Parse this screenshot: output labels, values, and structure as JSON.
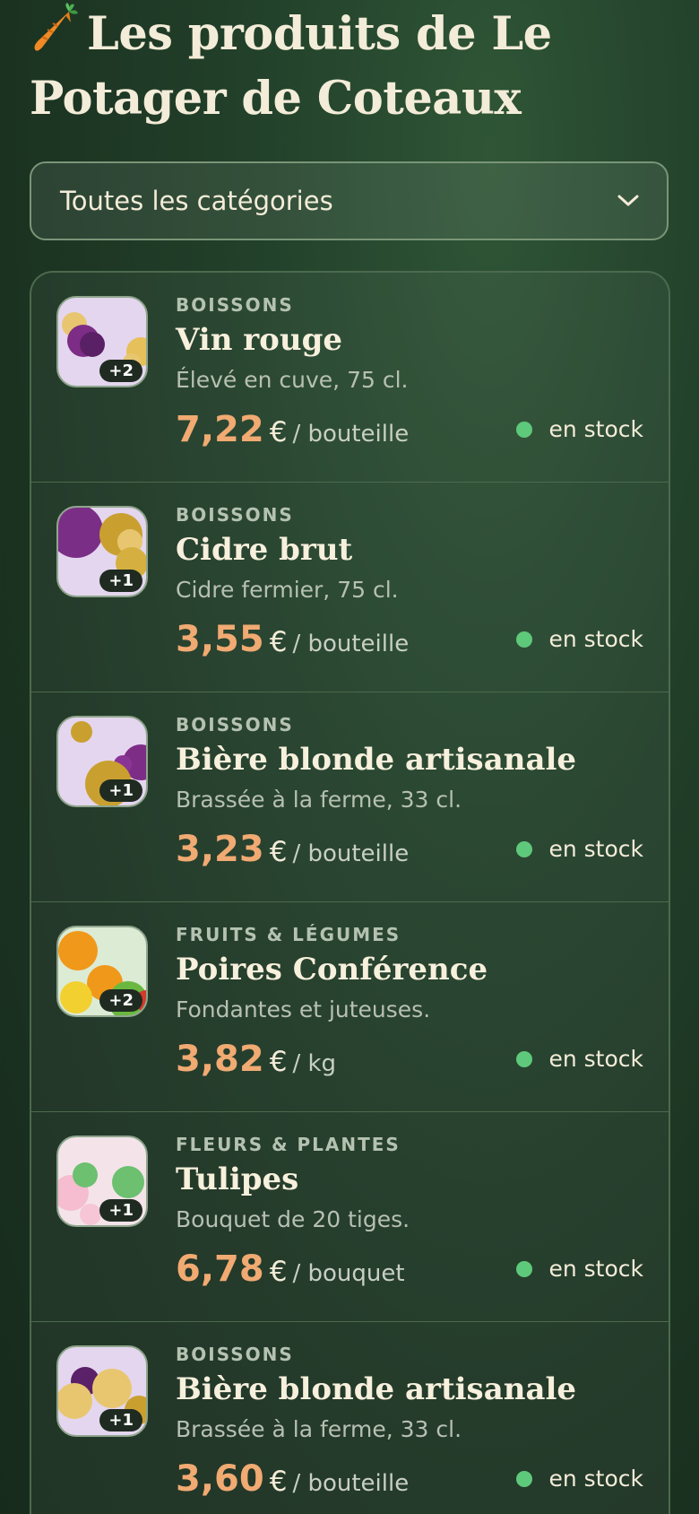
{
  "header": {
    "title": "Les produits de Le Potager de Coteaux",
    "icon": "carrot-icon"
  },
  "filter": {
    "selected": "Toutes les catégories",
    "icon": "chevron-down-icon"
  },
  "products": [
    {
      "category": "BOISSONS",
      "name": "Vin rouge",
      "description": "Élevé en cuve, 75 cl.",
      "price": "7,22",
      "currency": "€",
      "unit": "/ bouteille",
      "stock": "en stock",
      "extra_images": "+2",
      "thumb_bg": "#e4d6ee"
    },
    {
      "category": "BOISSONS",
      "name": "Cidre brut",
      "description": "Cidre fermier, 75 cl.",
      "price": "3,55",
      "currency": "€",
      "unit": "/ bouteille",
      "stock": "en stock",
      "extra_images": "+1",
      "thumb_bg": "#e4d6ee"
    },
    {
      "category": "BOISSONS",
      "name": "Bière blonde artisanale",
      "description": "Brassée à la ferme, 33 cl.",
      "price": "3,23",
      "currency": "€",
      "unit": "/ bouteille",
      "stock": "en stock",
      "extra_images": "+1",
      "thumb_bg": "#e4d6ee"
    },
    {
      "category": "FRUITS & LÉGUMES",
      "name": "Poires Conférence",
      "description": "Fondantes et juteuses.",
      "price": "3,82",
      "currency": "€",
      "unit": "/ kg",
      "stock": "en stock",
      "extra_images": "+2",
      "thumb_bg": "#dcebd4"
    },
    {
      "category": "FLEURS & PLANTES",
      "name": "Tulipes",
      "description": "Bouquet de 20 tiges.",
      "price": "6,78",
      "currency": "€",
      "unit": "/ bouquet",
      "stock": "en stock",
      "extra_images": "+1",
      "thumb_bg": "#f4e4ea"
    },
    {
      "category": "BOISSONS",
      "name": "Bière blonde artisanale",
      "description": "Brassée à la ferme, 33 cl.",
      "price": "3,60",
      "currency": "€",
      "unit": "/ bouteille",
      "stock": "en stock",
      "extra_images": "+1",
      "thumb_bg": "#e4d6ee"
    }
  ],
  "colors": {
    "accent_price": "#f0aa72",
    "stock_dot": "#5ec97a",
    "background": "#1f3a26"
  }
}
